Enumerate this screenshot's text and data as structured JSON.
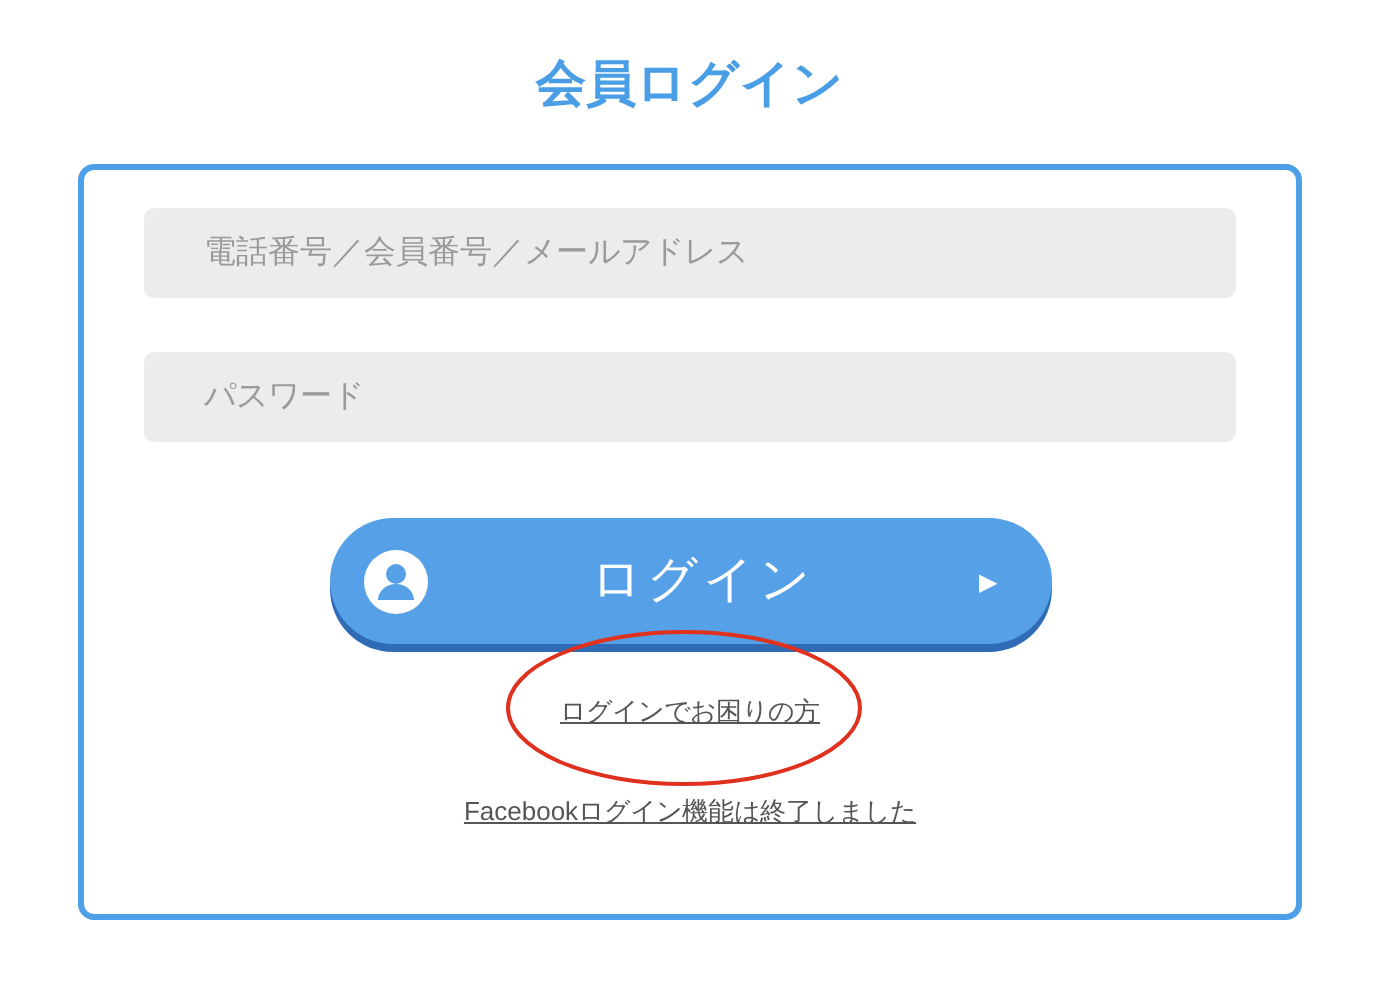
{
  "title": "会員ログイン",
  "fields": [
    {
      "placeholder": "電話番号／会員番号／メールアドレス"
    },
    {
      "placeholder": "パスワード"
    }
  ],
  "login_button": {
    "label": "ログイン",
    "arrow": "▶"
  },
  "links": [
    {
      "label": "ログインでお困りの方",
      "circled": true
    },
    {
      "label": "Facebookログイン機能は終了しました",
      "circled": false
    }
  ],
  "annotation": {
    "color": "#e0301e"
  }
}
